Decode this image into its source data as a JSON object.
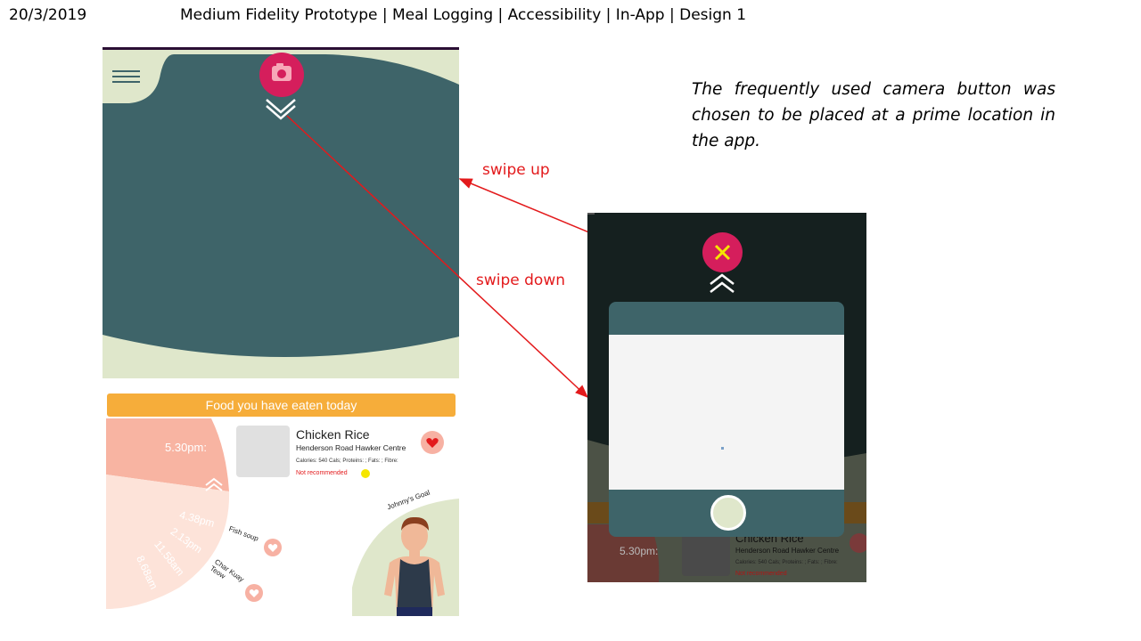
{
  "header": {
    "date": "20/3/2019",
    "title": "Medium Fidelity Prototype | Meal Logging | Accessibility | In-App | Design 1"
  },
  "annotation": {
    "note": "The frequently used camera button was chosen to be placed at a prime location in the app.",
    "swipe_up": "swipe up",
    "swipe_down": "swipe down"
  },
  "colors": {
    "dark_teal": "#3e6469",
    "sage": "#dfe7cb",
    "accent_pink": "#d51e5c",
    "orange": "#f6ad3a",
    "salmon": "#f7b1a3",
    "arrow_red": "#e31a1c"
  },
  "icons": {
    "menu": "hamburger-icon",
    "camera": "camera-icon",
    "chevron_down": "double-chevron-down-icon",
    "chevron_up": "double-chevron-up-icon",
    "close": "close-icon",
    "heart": "heart-icon"
  },
  "meal_log": {
    "banner": "Food you have eaten today",
    "timeline": {
      "time_1": "5.30pm:",
      "times_lower": [
        "4.38pm",
        "2.13pm",
        "11.58am",
        "8.68am"
      ]
    },
    "featured": {
      "name": "Chicken Rice",
      "place": "Henderson Road Hawker Centre",
      "nutrition": "Calories: 540 Cals; Proteins: ; Fats: ; Fibre:",
      "warning": "Not recommended"
    },
    "other_items": [
      "Fish soup",
      "Char Kuay Teow"
    ],
    "goal_label": "Johnny's Goal"
  },
  "phone2_background": {
    "time": "5.30pm:",
    "name": "Chicken Rice",
    "place": "Henderson Road Hawker Centre",
    "nutrition": "Calories: 540 Cals; Proteins: ; Fats: ; Fibre:",
    "warning": "Not recommended"
  }
}
